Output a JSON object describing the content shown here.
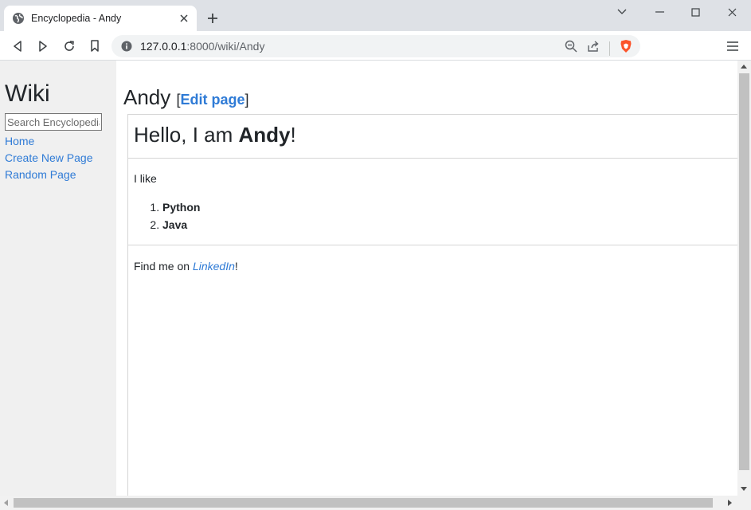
{
  "browser": {
    "tab_title": "Encyclopedia - Andy",
    "url_host": "127.0.0.1",
    "url_rest": ":8000/wiki/Andy",
    "accent_brave": "#fb542b"
  },
  "sidebar": {
    "title": "Wiki",
    "search_placeholder": "Search Encyclopedia",
    "links": [
      "Home",
      "Create New Page",
      "Random Page"
    ]
  },
  "main": {
    "page_title": "Andy",
    "edit_bracket_open": "[",
    "edit_label": "Edit page",
    "edit_bracket_close": "]",
    "heading_prefix": "Hello, I am ",
    "heading_name": "Andy",
    "heading_suffix": "!",
    "like_text": "I like",
    "languages": [
      "Python",
      "Java"
    ],
    "find_prefix": "Find me on ",
    "find_link": "LinkedIn",
    "find_suffix": "!"
  },
  "colors": {
    "link": "#2f7bd6",
    "sidebar_bg": "#f0f0f0",
    "titlebar_bg": "#dee1e6"
  }
}
